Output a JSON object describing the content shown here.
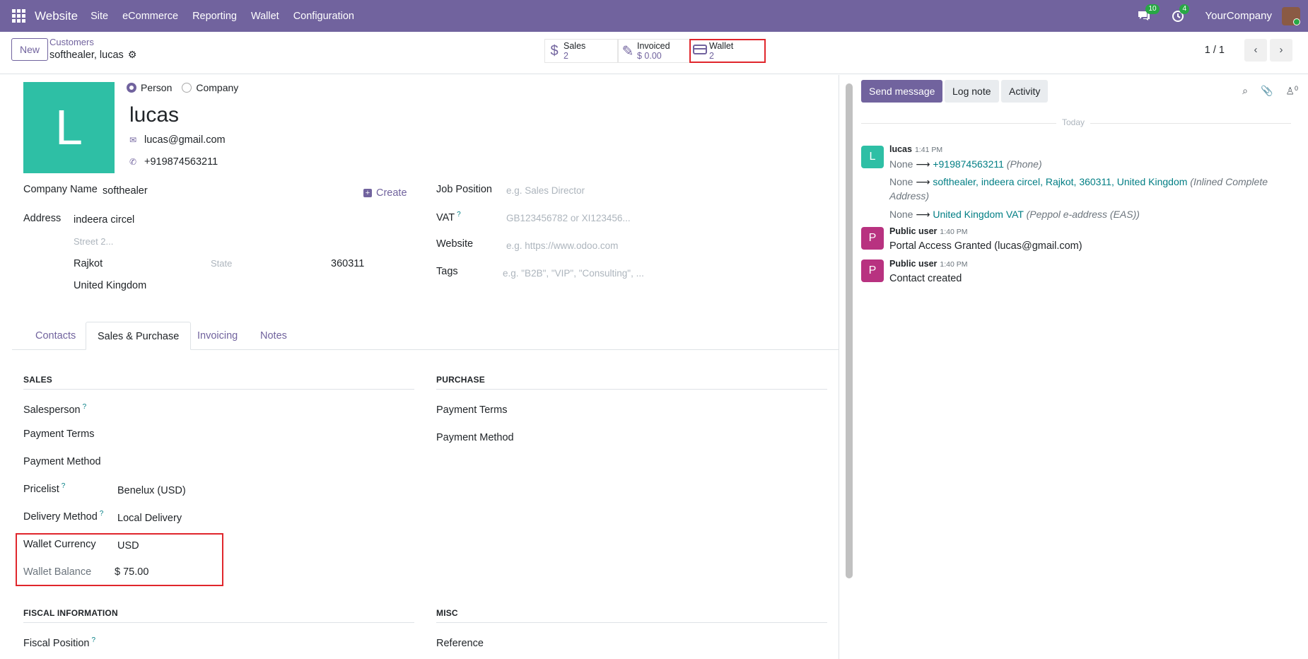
{
  "topbar": {
    "app_name": "Website",
    "menu": [
      "Site",
      "eCommerce",
      "Reporting",
      "Wallet",
      "Configuration"
    ],
    "messages_badge": "10",
    "activity_badge": "4",
    "company": "YourCompany"
  },
  "control": {
    "new_label": "New",
    "breadcrumb": "Customers",
    "record_name": "softhealer, lucas",
    "smart_buttons": [
      {
        "label": "Sales",
        "value": "2"
      },
      {
        "label": "Invoiced",
        "value": "$ 0.00"
      },
      {
        "label": "Wallet",
        "value": "2"
      }
    ],
    "pager": "1 / 1"
  },
  "form": {
    "avatar_letter": "L",
    "type_person": "Person",
    "type_company": "Company",
    "name": "lucas",
    "email": "lucas@gmail.com",
    "phone": "+919874563211",
    "company_name_label": "Company Name",
    "company_name": "softhealer",
    "create_label": "Create",
    "address_label": "Address",
    "street": "indeera circel",
    "street2_placeholder": "Street 2...",
    "city": "Rajkot",
    "state_placeholder": "State",
    "zip": "360311",
    "country": "United Kingdom",
    "job_position_label": "Job Position",
    "job_position_placeholder": "e.g. Sales Director",
    "vat_label": "VAT",
    "vat_placeholder": "GB123456782 or XI123456...",
    "website_label": "Website",
    "website_placeholder": "e.g. https://www.odoo.com",
    "tags_label": "Tags",
    "tags_placeholder": "e.g. \"B2B\", \"VIP\", \"Consulting\", ...",
    "tabs": [
      "Contacts",
      "Sales & Purchase",
      "Invoicing",
      "Notes"
    ],
    "sales": {
      "header": "SALES",
      "salesperson_label": "Salesperson",
      "payment_terms_label": "Payment Terms",
      "payment_method_label": "Payment Method",
      "pricelist_label": "Pricelist",
      "pricelist": "Benelux (USD)",
      "delivery_label": "Delivery Method",
      "delivery": "Local Delivery",
      "wallet_currency_label": "Wallet Currency",
      "wallet_currency": "USD",
      "wallet_balance_label": "Wallet Balance",
      "wallet_balance": "$ 75.00"
    },
    "purchase": {
      "header": "PURCHASE",
      "payment_terms_label": "Payment Terms",
      "payment_method_label": "Payment Method"
    },
    "fiscal": {
      "header": "FISCAL INFORMATION",
      "fiscal_position_label": "Fiscal Position"
    },
    "misc": {
      "header": "MISC",
      "reference_label": "Reference"
    }
  },
  "chatter": {
    "send_message": "Send message",
    "log_note": "Log note",
    "activity": "Activity",
    "followers_count": "0",
    "today": "Today",
    "messages": [
      {
        "avatar": "L",
        "author": "lucas",
        "time": "1:41 PM",
        "changes": [
          {
            "old": "None",
            "new": "+919874563211",
            "field": "(Phone)"
          },
          {
            "old": "None",
            "new": "softhealer, indeera circel, Rajkot, 360311, United Kingdom",
            "field": "(Inlined Complete Address)"
          },
          {
            "old": "None",
            "new": "United Kingdom VAT",
            "field": "(Peppol e-address (EAS))"
          }
        ]
      },
      {
        "avatar": "P",
        "author": "Public user",
        "time": "1:40 PM",
        "body": "Portal Access Granted (lucas@gmail.com)"
      },
      {
        "avatar": "P",
        "author": "Public user",
        "time": "1:40 PM",
        "body": "Contact created"
      }
    ]
  },
  "colors": {
    "brand": "#71639e",
    "teal": "#2ebfa5",
    "highlight": "#e0262c",
    "link": "#017e84",
    "public_avatar": "#b83280"
  }
}
